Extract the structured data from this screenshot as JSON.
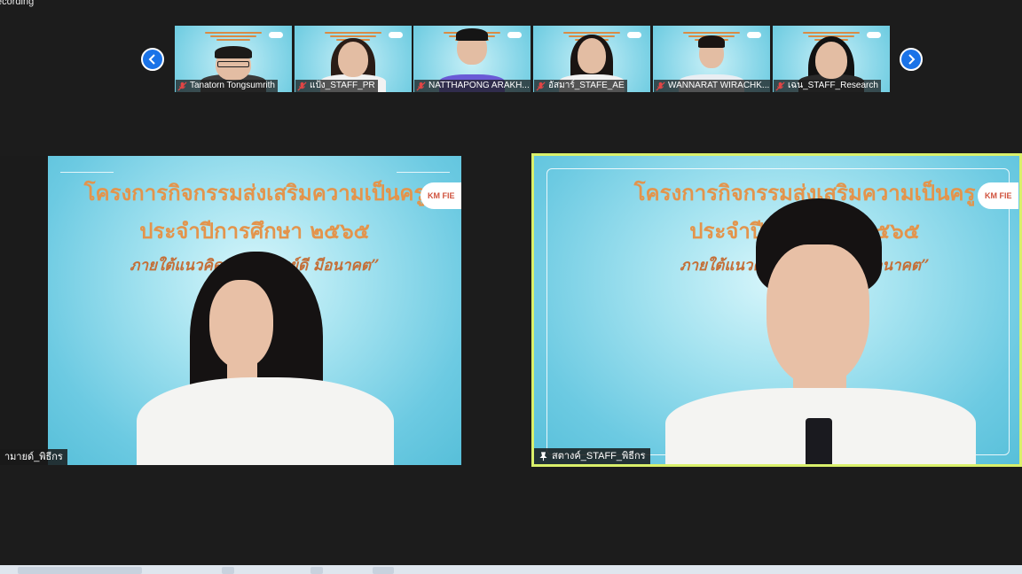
{
  "app": {
    "recording_label": "ecording"
  },
  "filmstrip": {
    "prev_icon": "chevron-left-icon",
    "next_icon": "chevron-right-icon",
    "participants": [
      {
        "name": "Tanatorn Tongsumrith",
        "muted": true
      },
      {
        "name": "แป้ง_STAFF_PR",
        "muted": true
      },
      {
        "name": "NATTHAPONG ARAKH...",
        "muted": true
      },
      {
        "name": "อัสมาร์_STAFE_AE",
        "muted": true
      },
      {
        "name": "WANNARAT WIRACHK...",
        "muted": true
      },
      {
        "name": "เฉน_STAFF_Research",
        "muted": true
      }
    ]
  },
  "main": {
    "left_tile": {
      "name": "ามายด์_พิธีกร",
      "slide": {
        "line1": "โครงการกิจกรรมส่งเสริมความเป็นครู",
        "line2": "ประจำปีการศึกษา ๒๕๖๕",
        "line3": "ภายใต้แนวคิด “ครูดี ศิษย์ดี มีอนาคต”",
        "logo": "KM FIE"
      }
    },
    "right_tile": {
      "name": "สตางค์_STAFF_พิธีกร",
      "active_speaker": true,
      "pinned": true,
      "slide": {
        "line1": "โครงการกิจกรรมส่งเสริมความเป็นครู",
        "line2": "ประจำปีการศึกษา ๒๕๖๕",
        "line3": "ภายใต้แนวคิด “ครูดี ศิษย์ดี มีอนาคต”",
        "logo": "KM FIE"
      }
    }
  },
  "colors": {
    "background": "#1c1c1c",
    "active_speaker_border": "#d9f06b",
    "nav_button": "#1a73e8",
    "slide_title": "#e3944c",
    "muted_mic": "#e04545"
  }
}
